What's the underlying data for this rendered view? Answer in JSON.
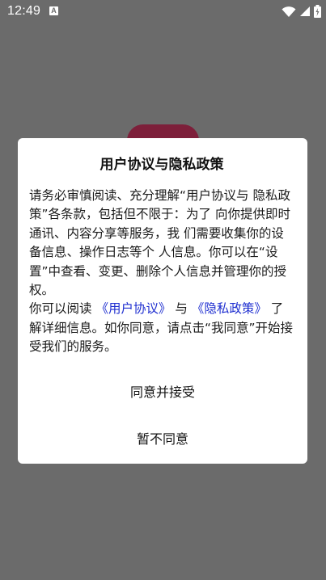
{
  "status_bar": {
    "time": "12:49",
    "notification_icon": "A"
  },
  "dialog": {
    "title": "用户协议与隐私政策",
    "paragraph1": " 请务必审慎阅读、充分理解“用户协议与 隐私政策”各条款，包括但不限于：为了 向你提供即时通讯、内容分享等服务，我 们需要收集你的设备信息、操作日志等个 人信息。你可以在“设置”中查看、变更、删除个人信息并管理你的授权。",
    "paragraph2": {
      "prefix": "你可以阅读 ",
      "user_agreement_link": "《用户协议》",
      "middle": " 与 ",
      "privacy_policy_link": "《隐私政策》",
      "suffix": " 了解详细信息。如你同意，请点击“我同意”开始接受我们的服务。"
    },
    "accept_label": "同意并接受",
    "decline_label": "暂不同意"
  },
  "colors": {
    "scrim": "#6b6b6b",
    "link": "#1f2fd0",
    "hidden_button": "#7d1f3a"
  }
}
